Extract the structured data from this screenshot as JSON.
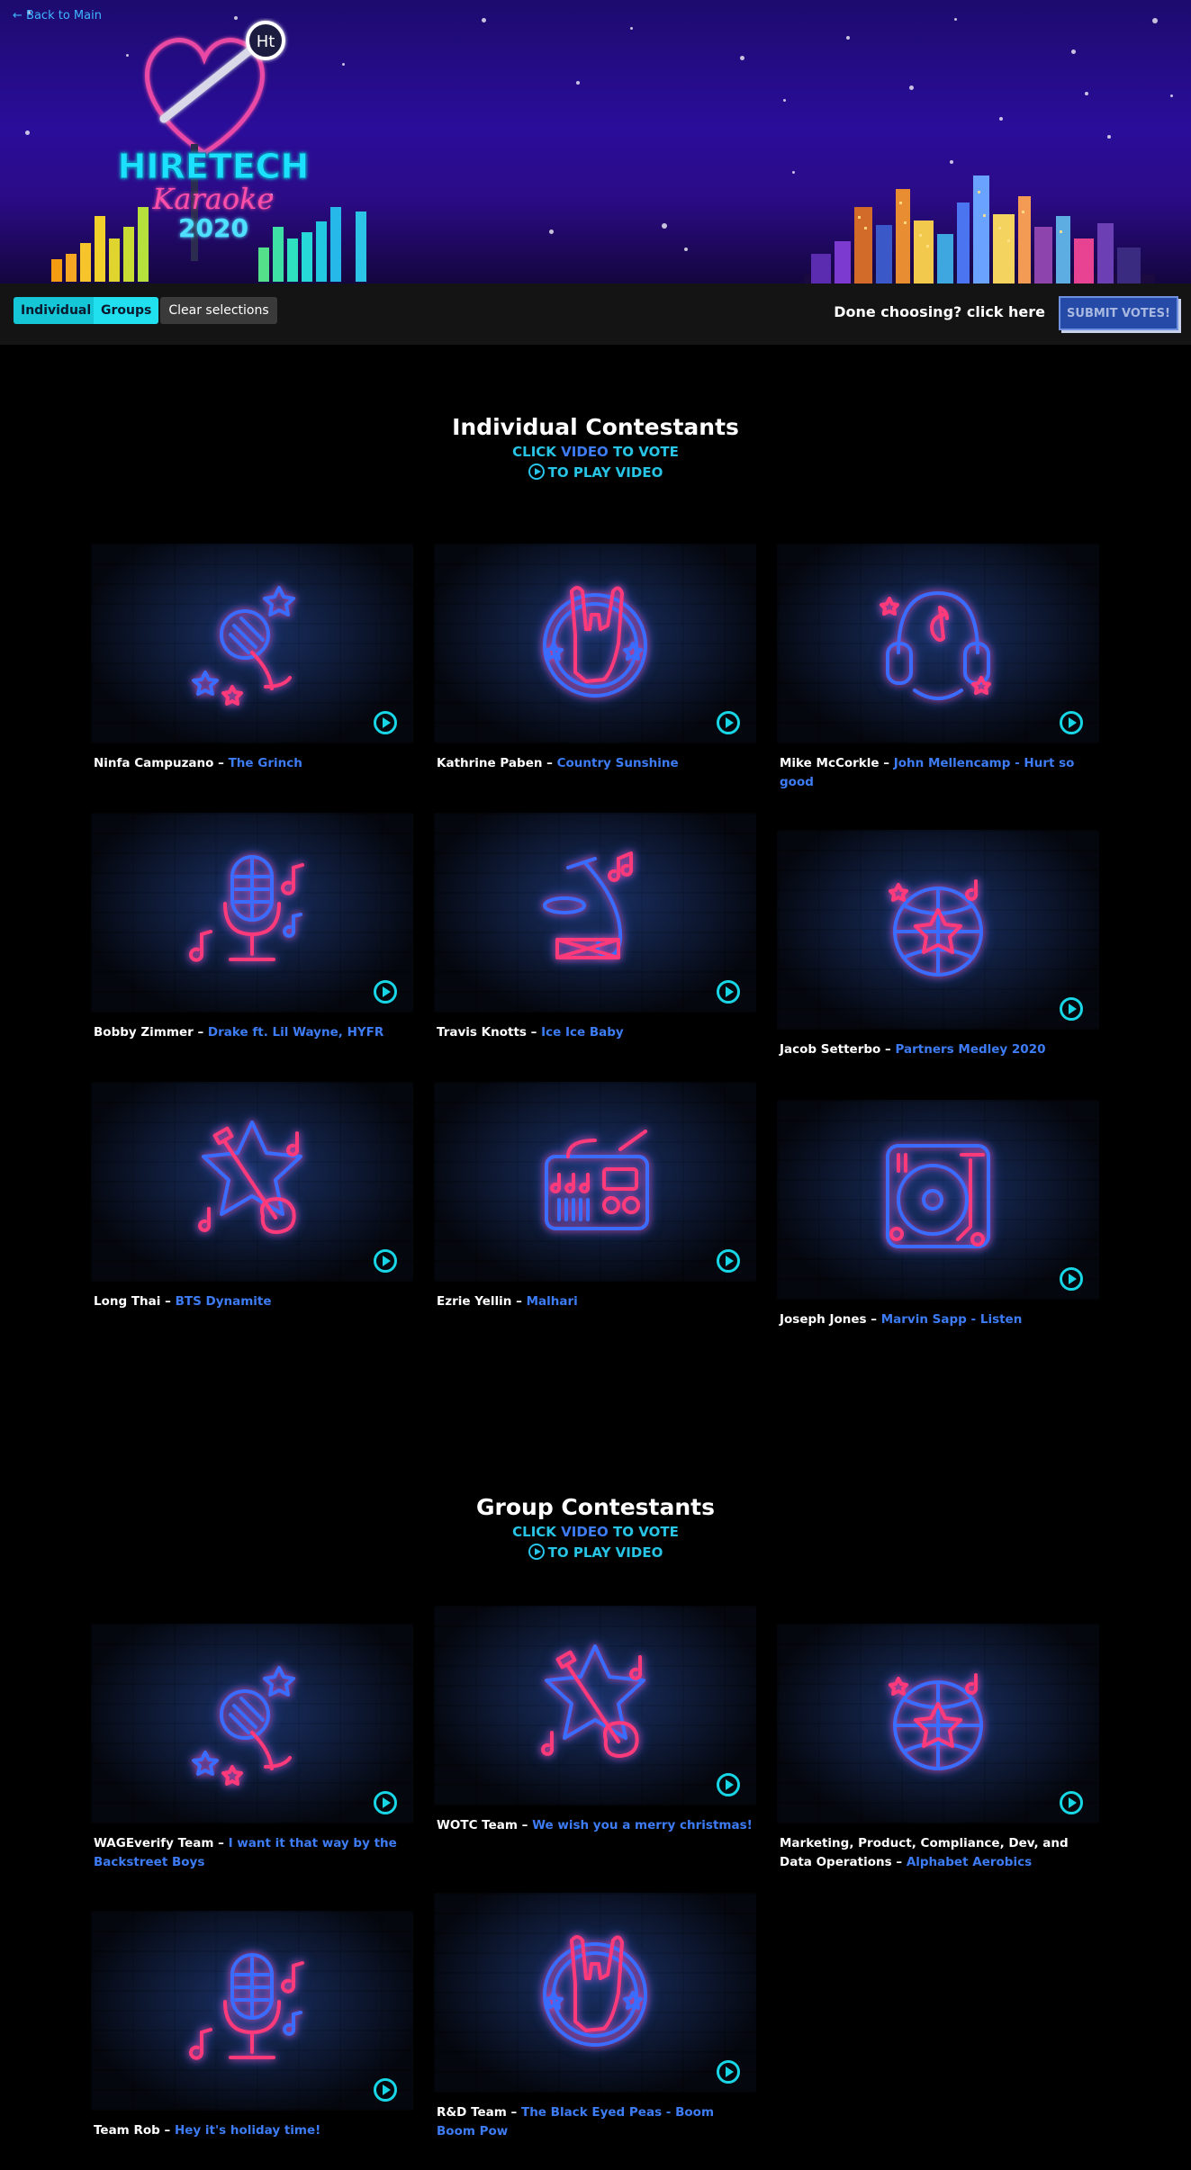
{
  "nav": {
    "back_label": "Back to Main"
  },
  "logo": {
    "brand": "HIRETECH",
    "script": "Karaoke",
    "year": "2020",
    "badge": "Ht"
  },
  "toolbar": {
    "individual_label": "Individual",
    "groups_label": "Groups",
    "clear_label": "Clear selections",
    "done_text": "Done choosing? click here",
    "submit_label": "SUBMIT VOTES!"
  },
  "colors": {
    "accent_cyan": "#18d6e6",
    "link_blue": "#3d7cf5",
    "neon_pink": "#ff3a7a",
    "neon_blue": "#3a6cff"
  },
  "individual": {
    "title": "Individual Contestants",
    "instr_click": "CLICK",
    "instr_video": "VIDEO",
    "instr_vote": "TO VOTE",
    "instr_play": "TO PLAY VIDEO",
    "cards": [
      {
        "name": "Ninfa Campuzano",
        "song": "The Grinch",
        "icon": "microphone-stars-icon"
      },
      {
        "name": "Kathrine Paben",
        "song": "Country Sunshine",
        "icon": "rock-hand-icon"
      },
      {
        "name": "Mike McCorkle",
        "song": "John Mellencamp - Hurt so good",
        "icon": "headphones-icon"
      },
      {
        "name": "Bobby Zimmer",
        "song": "Drake ft. Lil Wayne, HYFR",
        "icon": "studio-mic-icon"
      },
      {
        "name": "Travis Knotts",
        "song": "Ice Ice Baby",
        "icon": "saxophone-drum-icon"
      },
      {
        "name": "Jacob Setterbo",
        "song": "Partners Medley 2020",
        "icon": "disco-ball-icon"
      },
      {
        "name": "Long Thai",
        "song": "BTS Dynamite",
        "icon": "guitar-star-icon"
      },
      {
        "name": "Ezrie Yellin",
        "song": "Malhari",
        "icon": "boombox-icon"
      },
      {
        "name": "Joseph Jones",
        "song": "Marvin Sapp - Listen",
        "icon": "turntable-icon"
      }
    ]
  },
  "groups": {
    "title": "Group Contestants",
    "instr_click": "CLICK",
    "instr_video": "VIDEO",
    "instr_vote": "TO VOTE",
    "instr_play": "TO PLAY VIDEO",
    "cards": [
      {
        "name": "WAGEverify Team",
        "song": "I want it that way by the Backstreet Boys",
        "icon": "microphone-stars-icon"
      },
      {
        "name": "WOTC Team",
        "song": "We wish you a merry christmas!",
        "icon": "guitar-star-icon"
      },
      {
        "name": "Marketing, Product, Compliance, Dev, and Data Operations",
        "song": "Alphabet Aerobics",
        "icon": "disco-ball-icon"
      },
      {
        "name": "Team Rob",
        "song": "Hey it's holiday time!",
        "icon": "studio-mic-icon"
      },
      {
        "name": "R&D Team",
        "song": "The Black Eyed Peas - Boom Boom Pow",
        "icon": "rock-hand-icon"
      }
    ]
  }
}
